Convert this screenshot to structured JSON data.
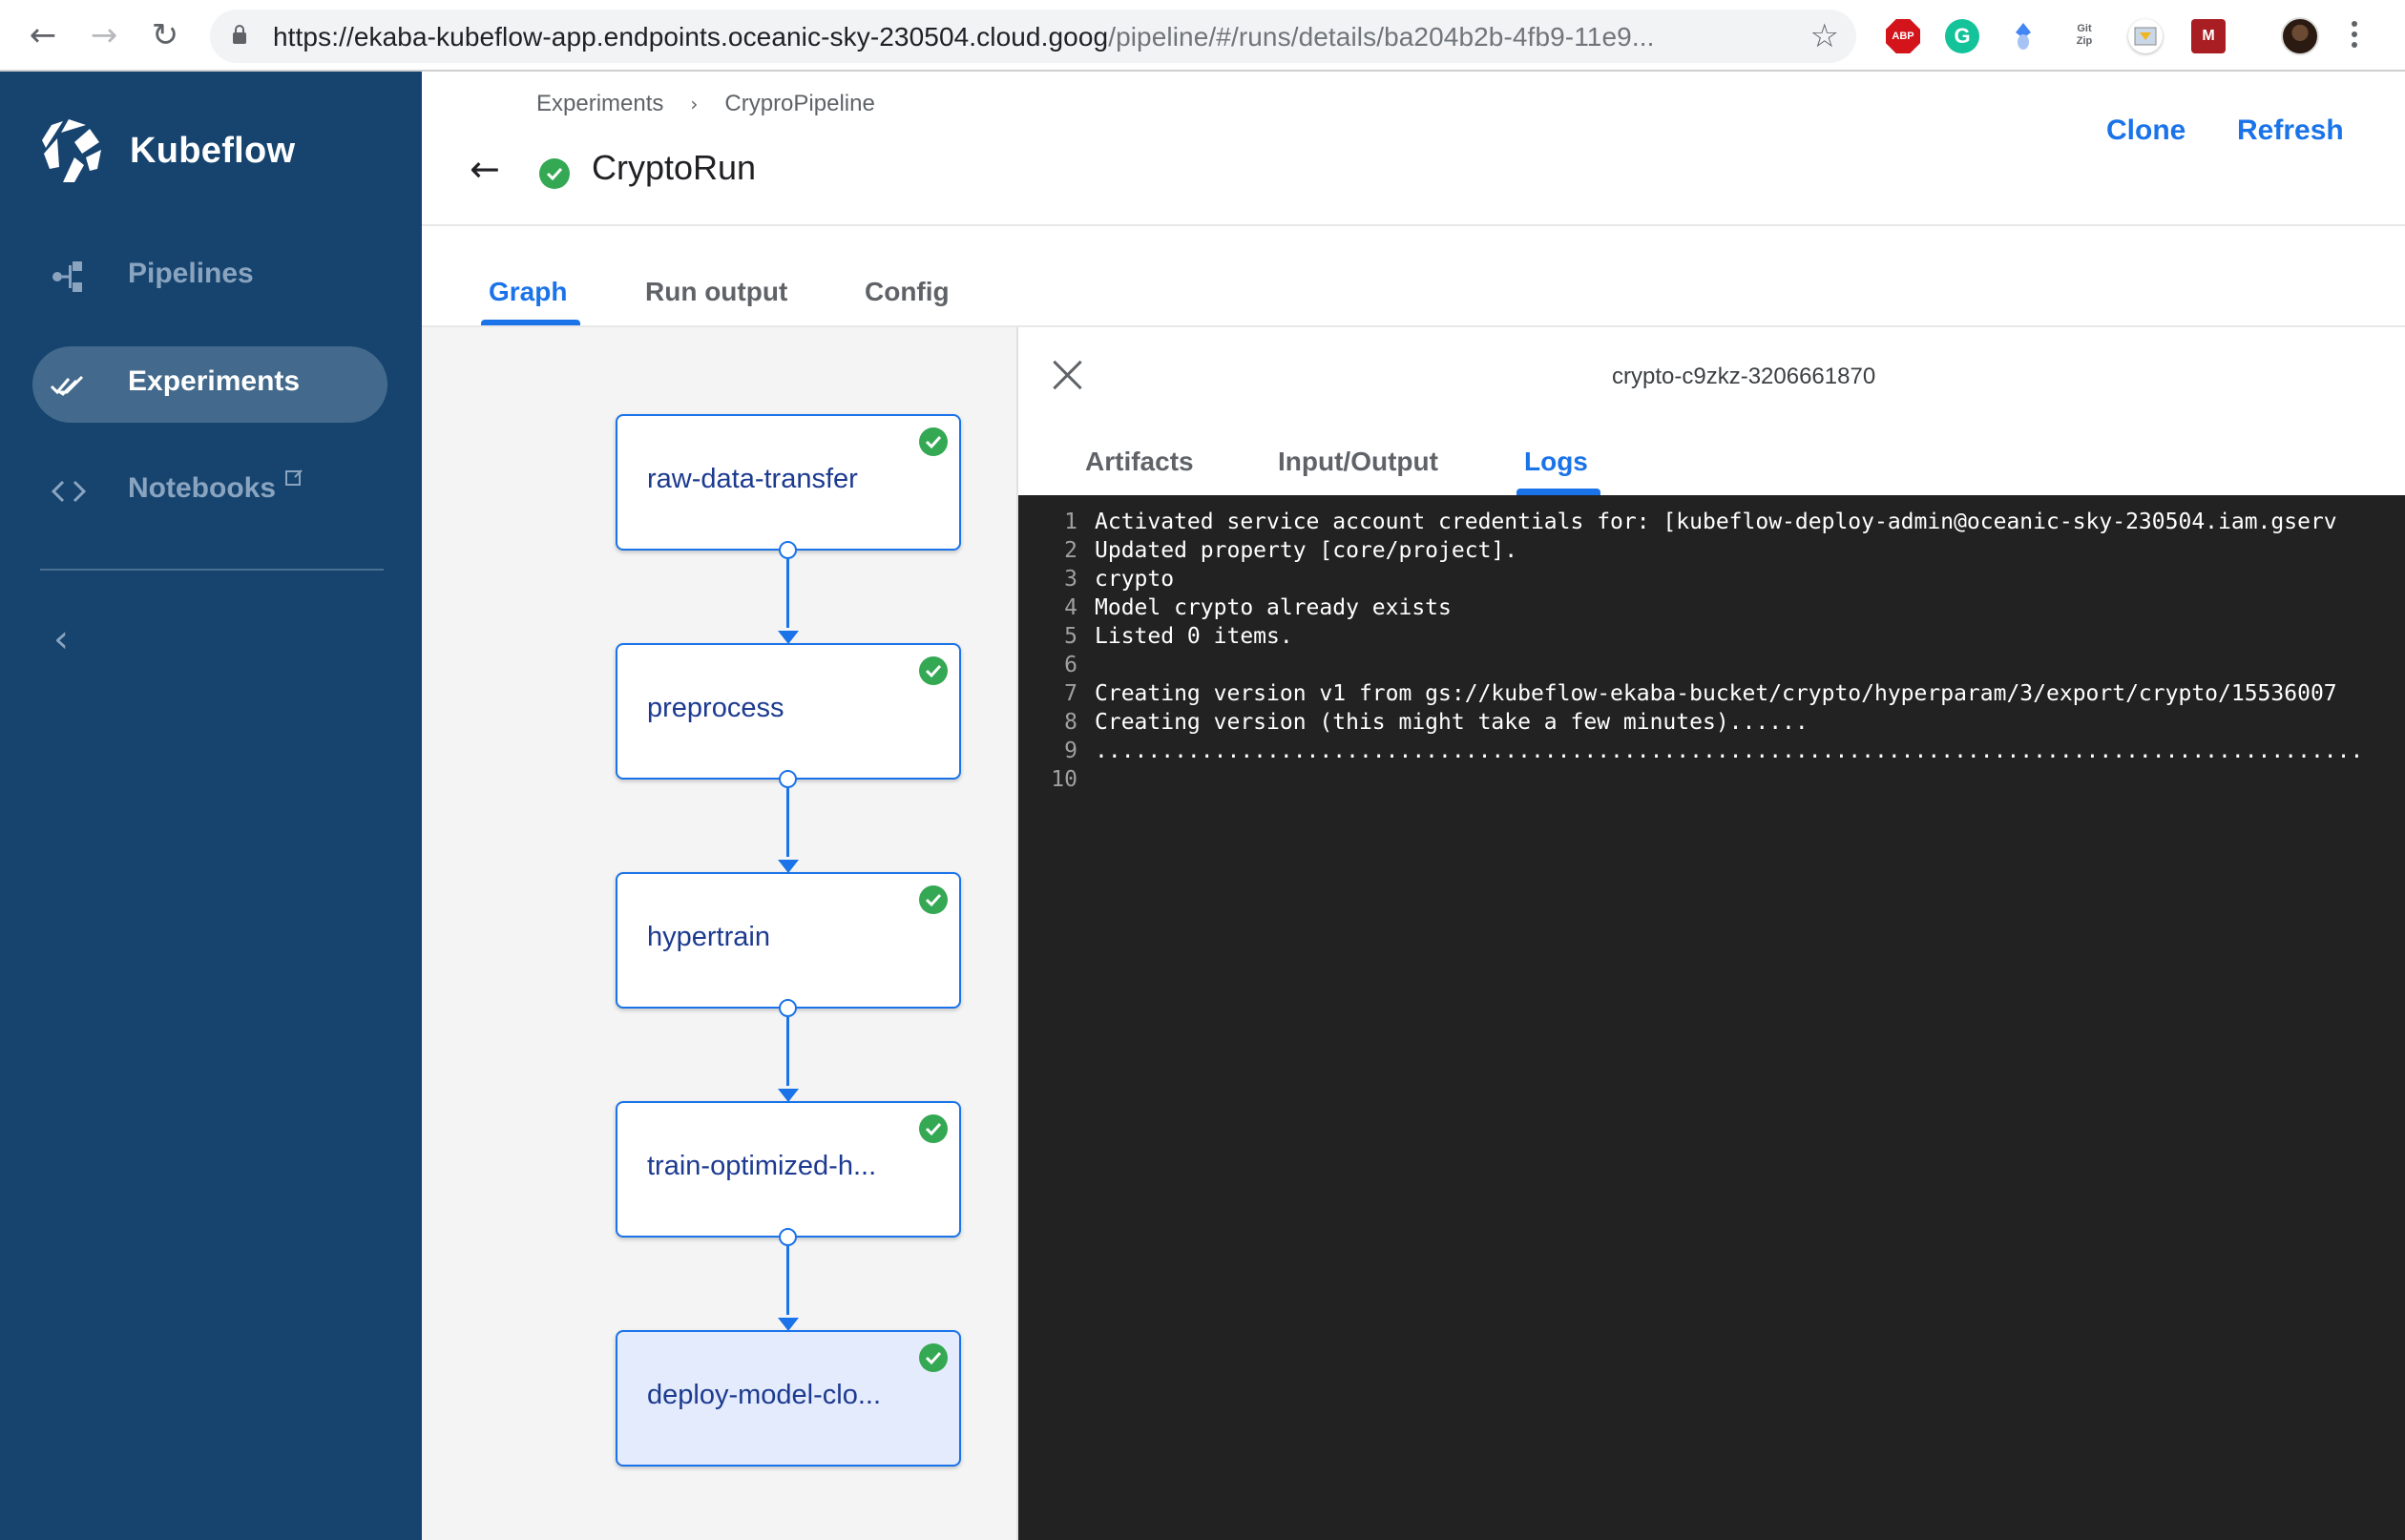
{
  "browser": {
    "url_main": "https://ekaba-kubeflow-app.endpoints.oceanic-sky-230504.cloud.goog",
    "url_rest": "/pipeline/#/runs/details/ba204b2b-4fb9-11e9...",
    "extensions": [
      {
        "name": "adblock-plus",
        "label": "ABP"
      },
      {
        "name": "grammarly",
        "label": "G"
      },
      {
        "name": "shape-extension",
        "label": ""
      },
      {
        "name": "gitzip",
        "label": "Git Zip"
      },
      {
        "name": "image-downloader",
        "label": ""
      },
      {
        "name": "mendeley",
        "label": "M"
      }
    ]
  },
  "sidebar": {
    "brand": "Kubeflow",
    "items": [
      {
        "label": "Pipelines",
        "icon": "pipelines-icon",
        "active": false
      },
      {
        "label": "Experiments",
        "icon": "experiments-icon",
        "active": true
      },
      {
        "label": "Notebooks",
        "icon": "code-icon",
        "active": false,
        "external": true
      }
    ]
  },
  "header": {
    "breadcrumb": [
      "Experiments",
      "CryproPipeline"
    ],
    "title": "CryptoRun",
    "status": "succeeded",
    "actions": {
      "clone": "Clone",
      "refresh": "Refresh"
    }
  },
  "tabs": [
    {
      "label": "Graph",
      "active": true
    },
    {
      "label": "Run output",
      "active": false
    },
    {
      "label": "Config",
      "active": false
    }
  ],
  "graph": {
    "nodes": [
      {
        "label": "raw-data-transfer",
        "status": "succeeded",
        "selected": false
      },
      {
        "label": "preprocess",
        "status": "succeeded",
        "selected": false
      },
      {
        "label": "hypertrain",
        "status": "succeeded",
        "selected": false
      },
      {
        "label": "train-optimized-h...",
        "status": "succeeded",
        "selected": false
      },
      {
        "label": "deploy-model-clo...",
        "status": "succeeded",
        "selected": true
      }
    ]
  },
  "panel": {
    "pod_name": "crypto-c9zkz-3206661870",
    "tabs": [
      {
        "label": "Artifacts",
        "active": false
      },
      {
        "label": "Input/Output",
        "active": false
      },
      {
        "label": "Logs",
        "active": true
      }
    ],
    "logs": [
      {
        "num": "1",
        "text": "Activated service account credentials for: [kubeflow-deploy-admin@oceanic-sky-230504.iam.gserv"
      },
      {
        "num": "2",
        "text": "Updated property [core/project]."
      },
      {
        "num": "3",
        "text": "crypto"
      },
      {
        "num": "4",
        "text": "Model crypto already exists"
      },
      {
        "num": "5",
        "text": "Listed 0 items."
      },
      {
        "num": "6",
        "text": ""
      },
      {
        "num": "7",
        "text": "Creating version v1 from gs://kubeflow-ekaba-bucket/crypto/hyperparam/3/export/crypto/15536007"
      },
      {
        "num": "8",
        "text": "Creating version (this might take a few minutes)......"
      },
      {
        "num": "9",
        "text": "................................................................................................"
      },
      {
        "num": "10",
        "text": ""
      }
    ]
  },
  "colors": {
    "sidebar_bg": "#16446f",
    "accent": "#1a73e8",
    "success": "#34a853",
    "logs_bg": "#222222"
  }
}
